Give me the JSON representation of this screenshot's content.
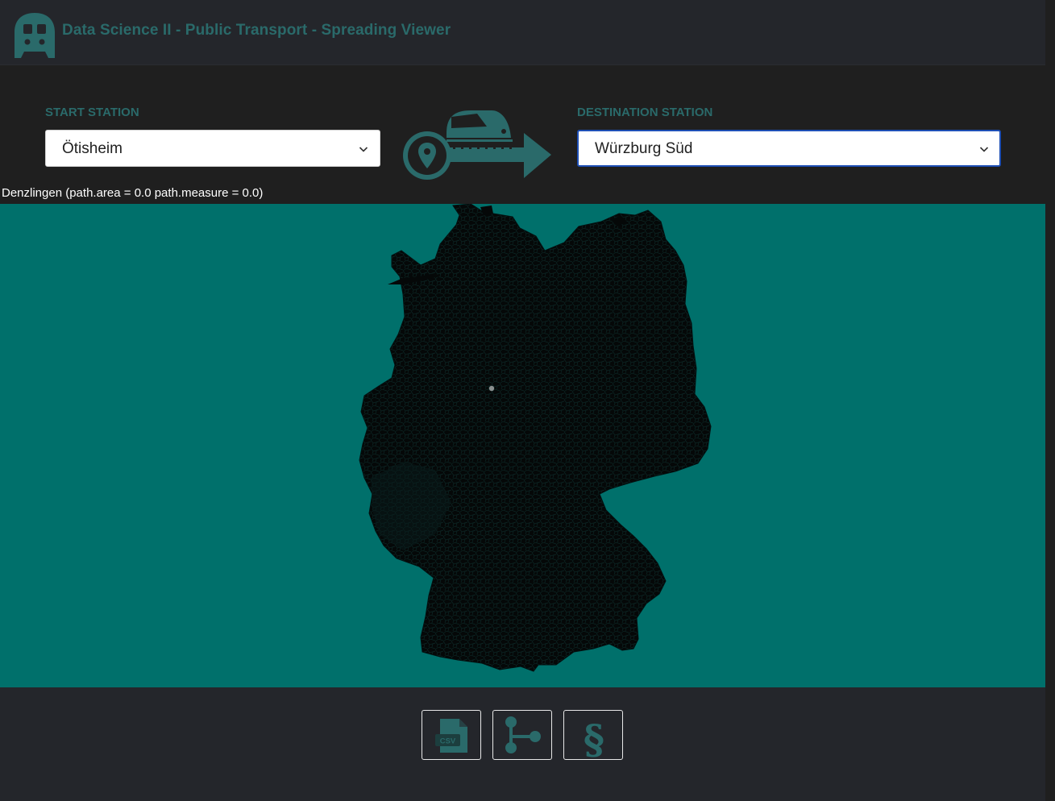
{
  "app": {
    "title": "Data Science II - Public Transport - Spreading Viewer",
    "logo_icon": "train-icon",
    "accent_color": "#2a6a6a"
  },
  "start": {
    "label": "START STATION",
    "value": "Ötisheim"
  },
  "destination": {
    "label": "DESTINATION STATION",
    "value": "Würzburg Süd"
  },
  "route_icon": "train-route-icon",
  "status_text": "Denzlingen (path.area = 0.0 path.measure = 0.0)",
  "map": {
    "background_color": "#00706b",
    "region_color": "#050808",
    "region": "Germany"
  },
  "toolbar": {
    "buttons": [
      {
        "name": "csv-export-button",
        "icon": "csv-file-icon",
        "text": "CSV"
      },
      {
        "name": "graph-button",
        "icon": "graph-branch-icon"
      },
      {
        "name": "legal-button",
        "icon": "section-sign-icon",
        "text": "§"
      }
    ]
  }
}
